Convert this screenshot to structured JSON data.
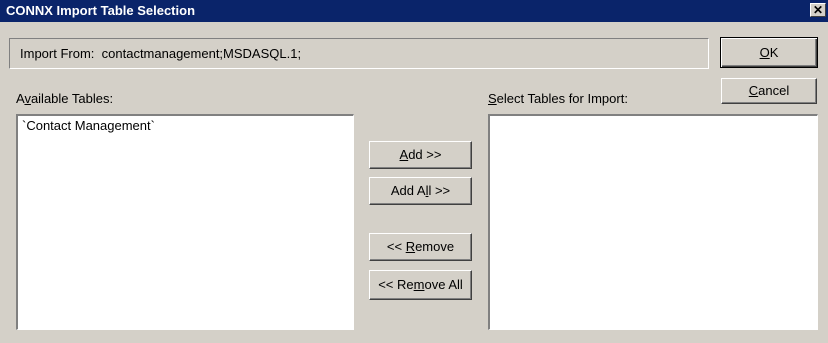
{
  "window": {
    "title": "CONNX Import Table Selection"
  },
  "import_from": {
    "label": "Import From:",
    "value": "contactmanagement;MSDASQL.1;"
  },
  "buttons": {
    "ok": {
      "pre": "",
      "ul": "O",
      "post": "K"
    },
    "cancel": {
      "pre": "",
      "ul": "C",
      "post": "ancel"
    },
    "add": {
      "pre": "",
      "ul": "A",
      "post": "dd >>"
    },
    "add_all": {
      "pre": "Add A",
      "ul": "l",
      "post": "l >>"
    },
    "remove": {
      "pre": "<< ",
      "ul": "R",
      "post": "emove"
    },
    "remove_all": {
      "pre": "<< Re",
      "ul": "m",
      "post": "ove All"
    }
  },
  "available_tables": {
    "label": {
      "pre": "A",
      "ul": "v",
      "post": "ailable Tables:"
    },
    "items": [
      "`Contact Management`"
    ]
  },
  "selected_tables": {
    "label": {
      "pre": "",
      "ul": "S",
      "post": "elect Tables for Import:"
    },
    "items": []
  },
  "icons": {
    "close": "close-icon"
  },
  "colors": {
    "titlebar": "#0a246a",
    "face": "#d4d0c8"
  }
}
